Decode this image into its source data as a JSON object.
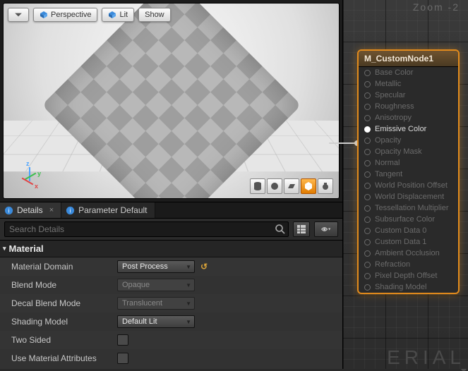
{
  "viewport": {
    "perspective_label": "Perspective",
    "lit_label": "Lit",
    "show_label": "Show",
    "axes": {
      "x": "x",
      "y": "y",
      "z": "z"
    },
    "primitives": [
      "cylinder",
      "sphere",
      "plane",
      "cube",
      "teapot"
    ],
    "active_primitive": 3
  },
  "tabs": {
    "details": "Details",
    "params": "Parameter Default"
  },
  "search": {
    "placeholder": "Search Details"
  },
  "material": {
    "section": "Material",
    "rows": {
      "domain_label": "Material Domain",
      "domain_value": "Post Process",
      "blend_label": "Blend Mode",
      "blend_value": "Opaque",
      "decal_label": "Decal Blend Mode",
      "decal_value": "Translucent",
      "shading_label": "Shading Model",
      "shading_value": "Default Lit",
      "twosided_label": "Two Sided",
      "useattrs_label": "Use Material Attributes"
    }
  },
  "graph": {
    "zoom_label": "Zoom -2",
    "watermark": "ERIAL",
    "node_title": "M_CustomNode1",
    "pins": [
      {
        "label": "Base Color",
        "active": false
      },
      {
        "label": "Metallic",
        "active": false
      },
      {
        "label": "Specular",
        "active": false
      },
      {
        "label": "Roughness",
        "active": false
      },
      {
        "label": "Anisotropy",
        "active": false
      },
      {
        "label": "Emissive Color",
        "active": true
      },
      {
        "label": "Opacity",
        "active": false
      },
      {
        "label": "Opacity Mask",
        "active": false
      },
      {
        "label": "Normal",
        "active": false
      },
      {
        "label": "Tangent",
        "active": false
      },
      {
        "label": "World Position Offset",
        "active": false
      },
      {
        "label": "World Displacement",
        "active": false
      },
      {
        "label": "Tessellation Multiplier",
        "active": false
      },
      {
        "label": "Subsurface Color",
        "active": false
      },
      {
        "label": "Custom Data 0",
        "active": false
      },
      {
        "label": "Custom Data 1",
        "active": false
      },
      {
        "label": "Ambient Occlusion",
        "active": false
      },
      {
        "label": "Refraction",
        "active": false
      },
      {
        "label": "Pixel Depth Offset",
        "active": false
      },
      {
        "label": "Shading Model",
        "active": false
      }
    ]
  }
}
